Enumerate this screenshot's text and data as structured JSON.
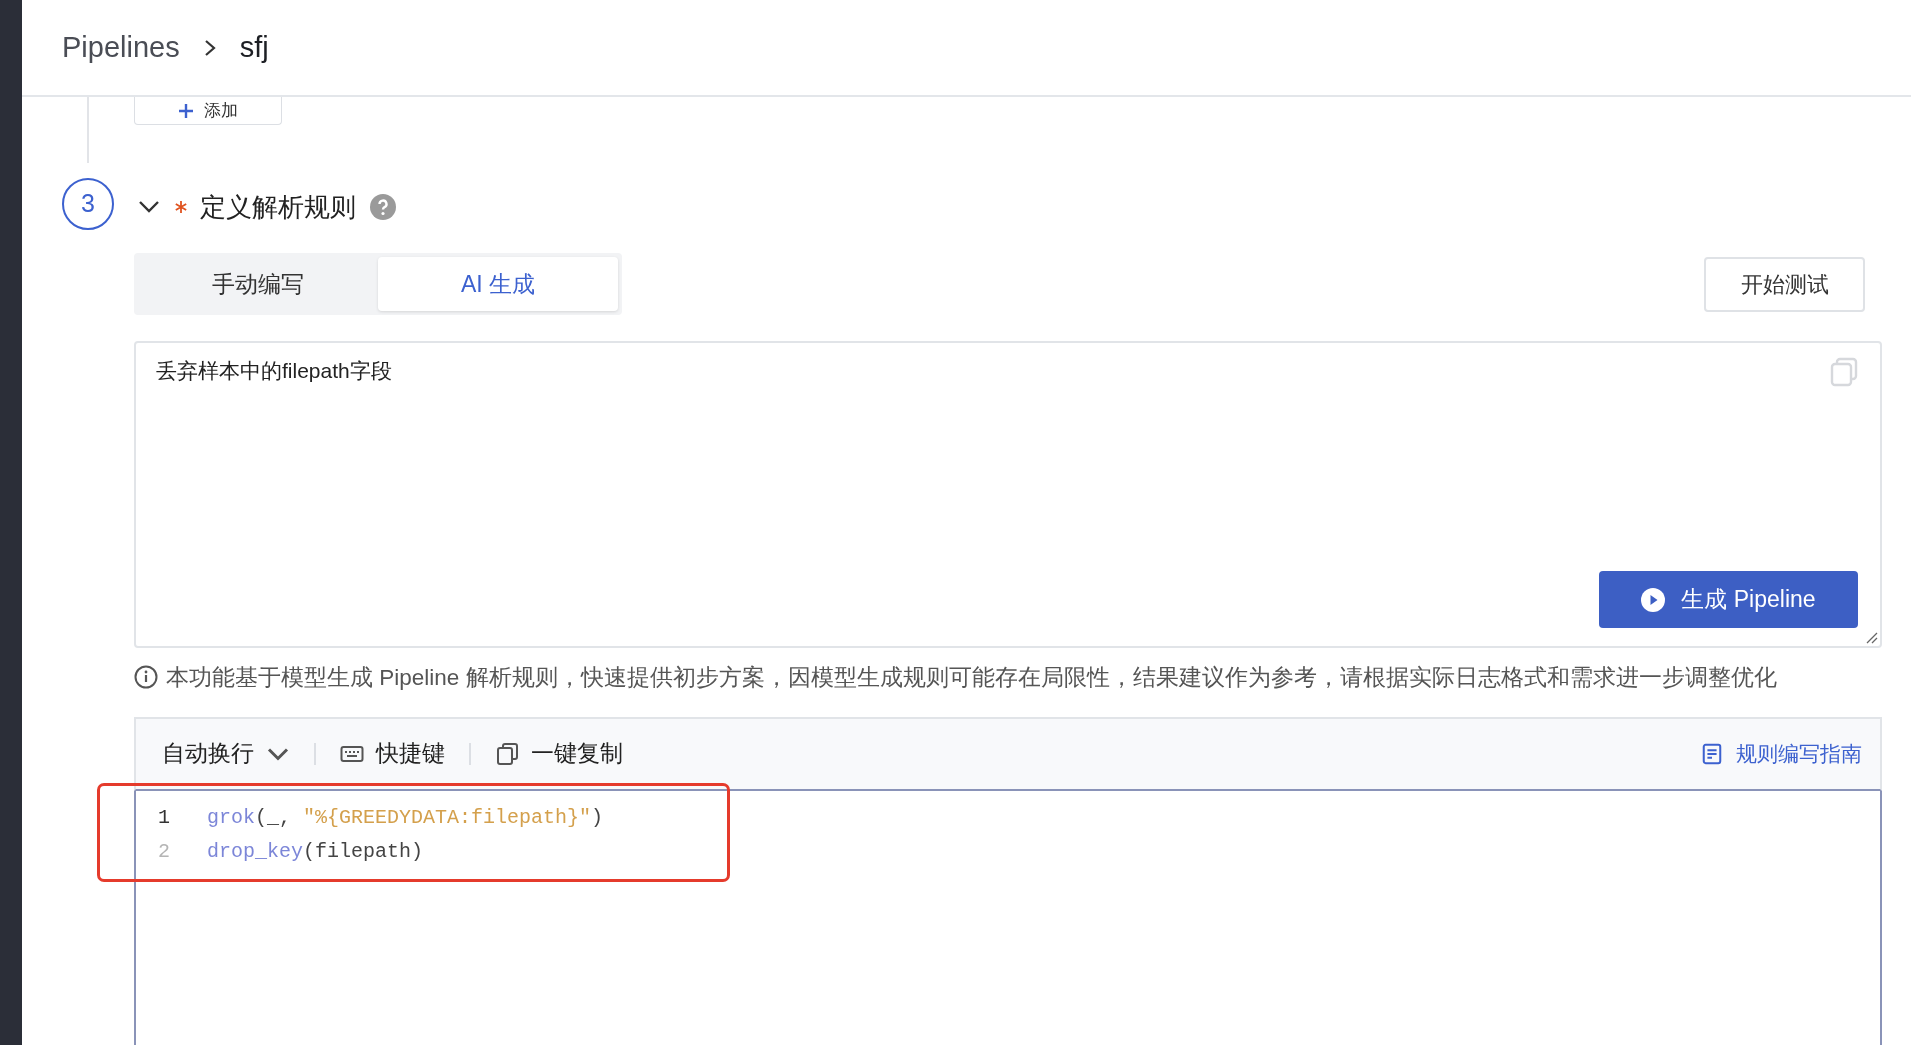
{
  "breadcrumb": [
    {
      "label": "Pipelines",
      "current": false
    },
    {
      "label": "sfj",
      "current": true
    }
  ],
  "add_button": {
    "label": "添加"
  },
  "step": {
    "number": "3",
    "expanded": true,
    "required": true,
    "title": "定义解析规则"
  },
  "tabs": [
    {
      "label": "手动编写",
      "selected": false
    },
    {
      "label": "AI 生成",
      "selected": true
    }
  ],
  "test_button": {
    "label": "开始测试"
  },
  "prompt": {
    "value": "丢弃样本中的filepath字段"
  },
  "generate_button": {
    "label": "生成 Pipeline"
  },
  "notice": "本功能基于模型生成 Pipeline 解析规则，快速提供初步方案，因模型生成规则可能存在局限性，结果建议作为参考，请根据实际日志格式和需求进一步调整优化",
  "editor": {
    "toolbar": [
      {
        "kind": "dropdown",
        "label": "自动换行"
      },
      {
        "kind": "keyboard",
        "label": "快捷键"
      },
      {
        "kind": "copy",
        "label": "一键复制"
      }
    ],
    "guide_link": "规则编写指南",
    "lines": [
      {
        "number": "1",
        "active": true,
        "tokens": [
          {
            "kind": "fn",
            "text": "grok"
          },
          {
            "kind": "plain",
            "text": "(_, "
          },
          {
            "kind": "string",
            "text": "\"%{GREEDYDATA:filepath}\""
          },
          {
            "kind": "plain",
            "text": ")"
          }
        ]
      },
      {
        "number": "2",
        "active": false,
        "tokens": [
          {
            "kind": "fn",
            "text": "drop_key"
          },
          {
            "kind": "plain",
            "text": "(filepath)"
          }
        ]
      }
    ],
    "highlighted": true
  }
}
